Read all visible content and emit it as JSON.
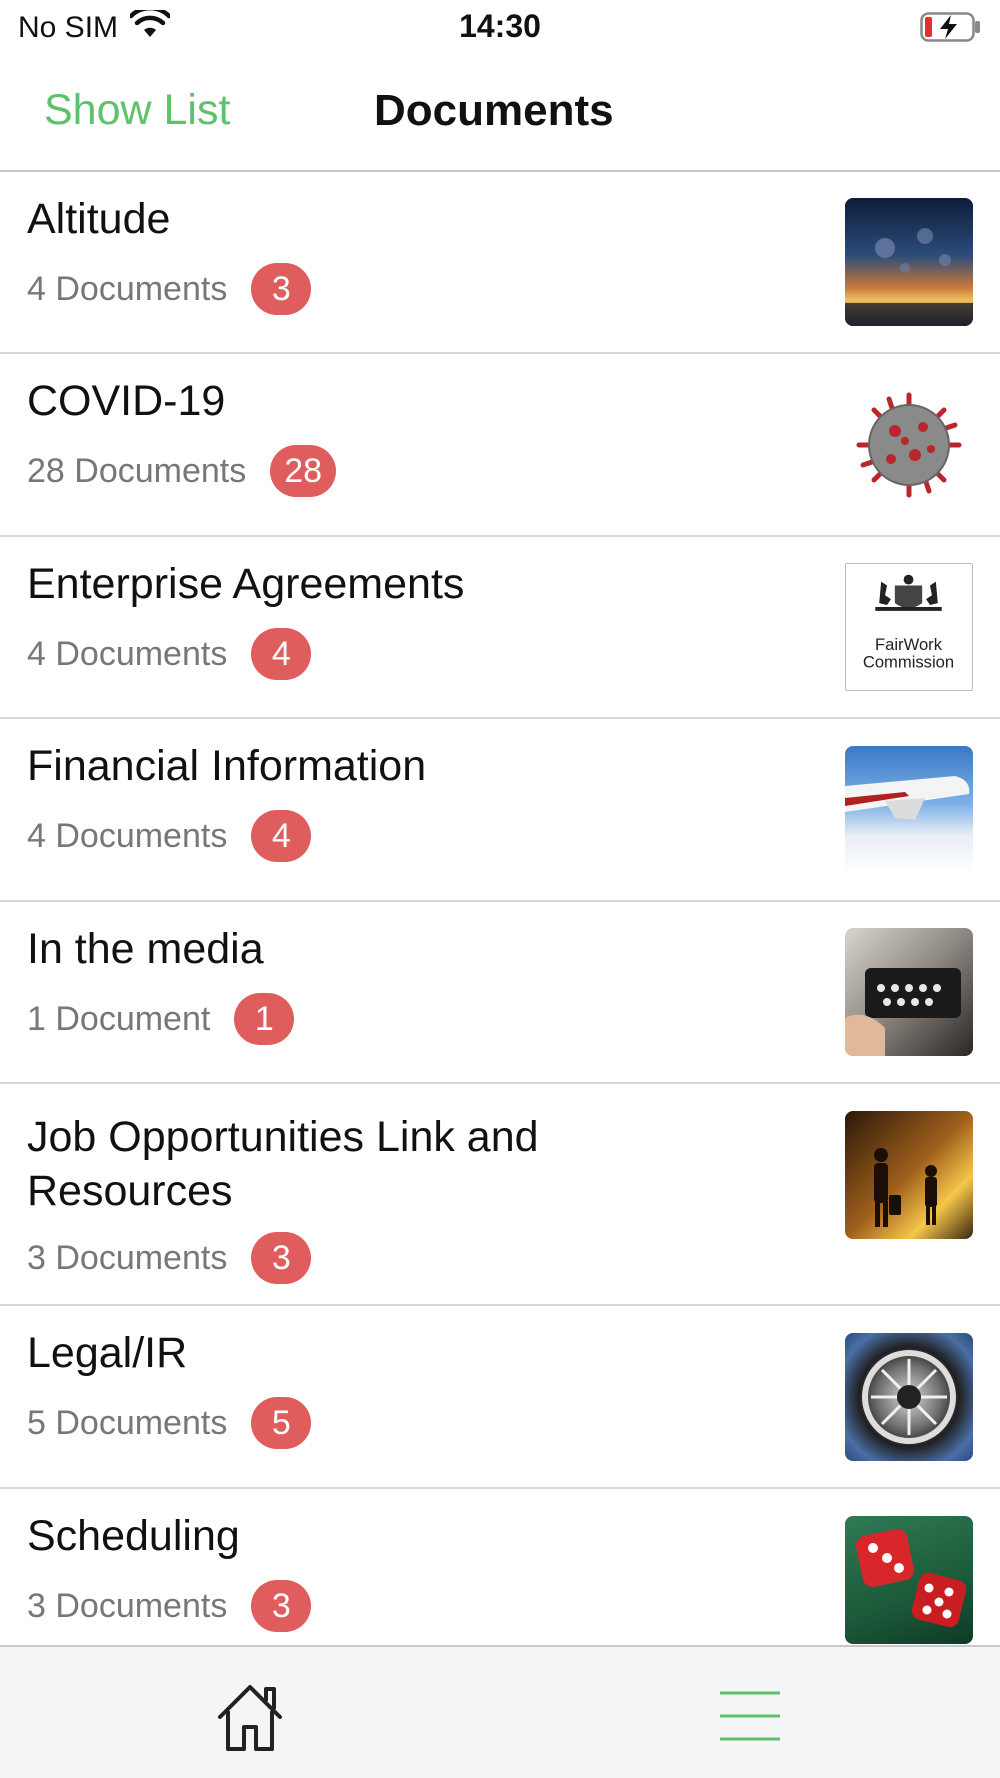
{
  "status_bar": {
    "carrier": "No SIM",
    "time": "14:30",
    "icons": [
      "wifi-icon",
      "battery-charging-icon"
    ]
  },
  "nav": {
    "left_button": "Show List",
    "title": "Documents"
  },
  "rows": [
    {
      "title": "Altitude",
      "count": "4 Documents",
      "badge": "3",
      "thumb_icon": "altitude-magazine-thumbnail"
    },
    {
      "title": "COVID-19",
      "count": "28 Documents",
      "badge": "28",
      "thumb_icon": "coronavirus-thumbnail"
    },
    {
      "title": "Enterprise Agreements",
      "count": "4 Documents",
      "badge": "4",
      "thumb_icon": "fairwork-commission-thumbnail",
      "thumb_text": [
        "FairWork",
        "Commission"
      ]
    },
    {
      "title": "Financial Information",
      "count": "4 Documents",
      "badge": "4",
      "thumb_icon": "airplane-thumbnail"
    },
    {
      "title": "In the media",
      "count": "1 Document",
      "badge": "1",
      "thumb_icon": "typewriter-thumbnail"
    },
    {
      "title": "Job Opportunities Link and Resources",
      "count": "3 Documents",
      "badge": "3",
      "thumb_icon": "travellers-thumbnail"
    },
    {
      "title": "Legal/IR",
      "count": "5 Documents",
      "badge": "5",
      "thumb_icon": "jet-engine-thumbnail"
    },
    {
      "title": "Scheduling",
      "count": "3 Documents",
      "badge": "3",
      "thumb_icon": "dice-thumbnail"
    }
  ],
  "tab_bar": {
    "items": [
      "home-icon",
      "menu-icon"
    ],
    "accent_color": "#5ec26b"
  },
  "colors": {
    "accent": "#5ec26b",
    "badge": "#e05d5d"
  }
}
